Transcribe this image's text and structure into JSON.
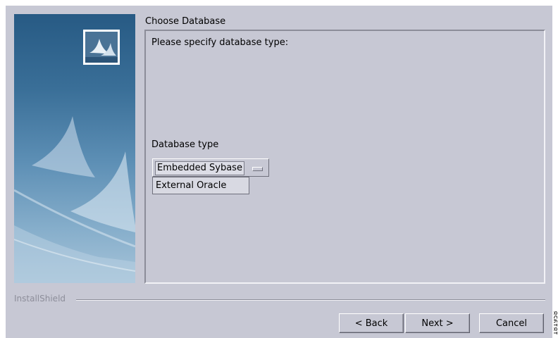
{
  "wizard": {
    "section_title": "Choose Database",
    "prompt": "Please specify database type:",
    "database_type_label": "Database type",
    "database_type_select": {
      "selected": "Embedded Sybase",
      "options": [
        "External Oracle"
      ]
    },
    "brand": "InstallShield",
    "buttons": {
      "back": "< Back",
      "next": "Next >",
      "cancel": "Cancel"
    }
  },
  "figure_id": "181958",
  "colors": {
    "window_bg": "#c7c8d4",
    "side_panel_top": "#275a84",
    "side_panel_bottom": "#a7c4d9",
    "brand_text": "#8d8e9a"
  },
  "icons": {
    "logo": "installshield-sails-logo",
    "dropdown_indicator": "combo-box-indicator"
  }
}
